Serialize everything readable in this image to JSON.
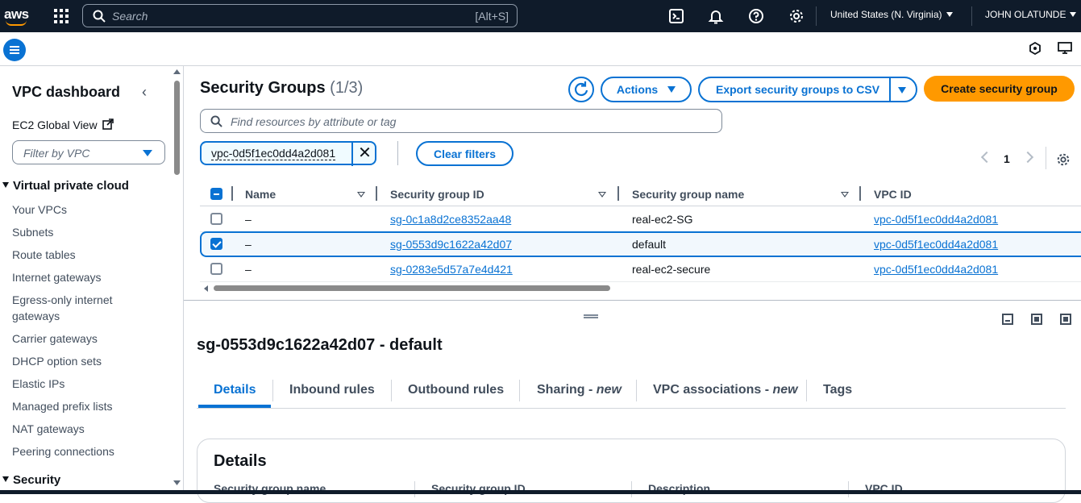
{
  "topnav": {
    "logo_text": "aws",
    "search_placeholder": "Search",
    "search_shortcut": "[Alt+S]",
    "icons": [
      "cloudshell-icon",
      "bell-icon",
      "help-icon",
      "gear-icon"
    ],
    "region": "United States (N. Virginia)",
    "user": "JOHN OLATUNDE"
  },
  "sidebar": {
    "title": "VPC dashboard",
    "ec2_global_view": "EC2 Global View",
    "filter_placeholder": "Filter by VPC",
    "section_vpc": "Virtual private cloud",
    "items": [
      "Your VPCs",
      "Subnets",
      "Route tables",
      "Internet gateways",
      "Egress-only internet gateways",
      "Carrier gateways",
      "DHCP option sets",
      "Elastic IPs",
      "Managed prefix lists",
      "NAT gateways",
      "Peering connections"
    ],
    "section_security": "Security"
  },
  "main": {
    "title": "Security Groups",
    "count": "(1/3)",
    "actions_label": "Actions",
    "export_label": "Export security groups to CSV",
    "create_label": "Create security group",
    "find_placeholder": "Find resources by attribute or tag",
    "filter_token": "vpc-0d5f1ec0dd4a2d081",
    "clear_filters": "Clear filters",
    "page_number": "1"
  },
  "table": {
    "columns": [
      "Name",
      "Security group ID",
      "Security group name",
      "VPC ID"
    ],
    "rows": [
      {
        "selected": false,
        "name": "–",
        "sg_id": "sg-0c1a8d2ce8352aa48",
        "sg_name": "real-ec2-SG",
        "vpc_id": "vpc-0d5f1ec0dd4a2d081"
      },
      {
        "selected": true,
        "name": "–",
        "sg_id": "sg-0553d9c1622a42d07",
        "sg_name": "default",
        "vpc_id": "vpc-0d5f1ec0dd4a2d081"
      },
      {
        "selected": false,
        "name": "–",
        "sg_id": "sg-0283e5d57a7e4d421",
        "sg_name": "real-ec2-secure",
        "vpc_id": "vpc-0d5f1ec0dd4a2d081"
      }
    ]
  },
  "detail": {
    "title": "sg-0553d9c1622a42d07 - default",
    "tabs": [
      {
        "label": "Details",
        "suffix": ""
      },
      {
        "label": "Inbound rules",
        "suffix": ""
      },
      {
        "label": "Outbound rules",
        "suffix": ""
      },
      {
        "label": "Sharing - ",
        "suffix": "new"
      },
      {
        "label": "VPC associations - ",
        "suffix": "new"
      },
      {
        "label": "Tags",
        "suffix": ""
      }
    ],
    "active_tab": "Details",
    "card_title": "Details",
    "card_columns": [
      "Security group name",
      "Security group ID",
      "Description",
      "VPC ID"
    ]
  },
  "colors": {
    "nav_bg": "#0f1b2a",
    "accent": "#0972d3",
    "primary_button": "#ff9900"
  }
}
